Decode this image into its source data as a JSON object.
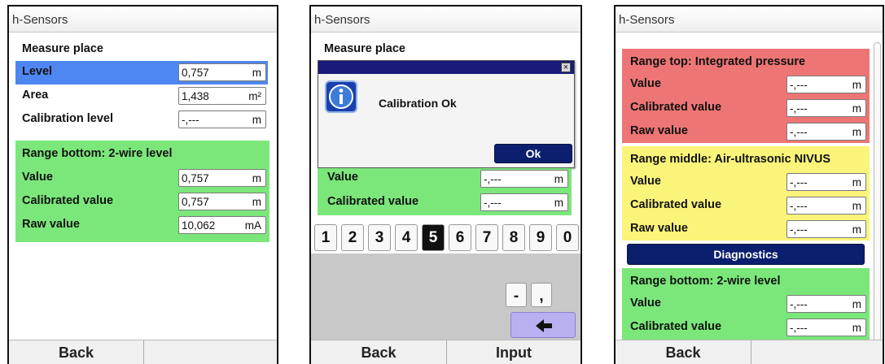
{
  "screens": [
    {
      "title": "h-Sensors",
      "measure_place": {
        "header": "Measure place",
        "level": {
          "label": "Level",
          "value": "0,757",
          "unit": "m"
        },
        "area": {
          "label": "Area",
          "value": "1,438",
          "unit": "m²"
        },
        "calibration_level": {
          "label": "Calibration level",
          "value": "-,---",
          "unit": "m"
        }
      },
      "range_bottom": {
        "header": "Range bottom: 2-wire level",
        "value": {
          "label": "Value",
          "value": "0,757",
          "unit": "m"
        },
        "calibrated_value": {
          "label": "Calibrated value",
          "value": "0,757",
          "unit": "m"
        },
        "raw_value": {
          "label": "Raw value",
          "value": "10,062",
          "unit": "mA"
        }
      },
      "footer": {
        "back": "Back"
      }
    },
    {
      "title": "h-Sensors",
      "measure_place_header": "Measure place",
      "dialog": {
        "message": "Calibration Ok",
        "ok": "Ok",
        "close": "×"
      },
      "value": {
        "label": "Value",
        "value": "-,---",
        "unit": "m"
      },
      "calibrated_value": {
        "label": "Calibrated value",
        "value": "-,---",
        "unit": "m"
      },
      "keypad": {
        "digits": [
          "1",
          "2",
          "3",
          "4",
          "5",
          "6",
          "7",
          "8",
          "9",
          "0"
        ],
        "selected": "5",
        "minus": "-",
        "comma": ",",
        "enter": "🡰"
      },
      "footer": {
        "back": "Back",
        "input": "Input"
      }
    },
    {
      "title": "h-Sensors",
      "range_top": {
        "header": "Range top: Integrated pressure",
        "value": {
          "label": "Value",
          "value": "-,---",
          "unit": "m"
        },
        "calibrated_value": {
          "label": "Calibrated value",
          "value": "-,---",
          "unit": "m"
        },
        "raw_value": {
          "label": "Raw value",
          "value": "-,---",
          "unit": "m"
        }
      },
      "range_middle": {
        "header": "Range middle: Air-ultrasonic NIVUS",
        "value": {
          "label": "Value",
          "value": "-,---",
          "unit": "m"
        },
        "calibrated_value": {
          "label": "Calibrated value",
          "value": "-,---",
          "unit": "m"
        },
        "raw_value": {
          "label": "Raw value",
          "value": "-,---",
          "unit": "m"
        }
      },
      "diagnostics": "Diagnostics",
      "range_bottom": {
        "header": "Range bottom: 2-wire level",
        "value": {
          "label": "Value",
          "value": "-,---",
          "unit": "m"
        },
        "calibrated_value": {
          "label": "Calibrated value",
          "value": "-,---",
          "unit": "m"
        }
      },
      "footer": {
        "back": "Back"
      }
    }
  ],
  "colors": {
    "selected_row": "#4f87f2",
    "range_bottom_bg": "#7be77b",
    "range_top_bg": "#ee7575",
    "range_middle_bg": "#fbf47a",
    "dialog_titlebar": "#1a1a7a",
    "button_navy": "#0c1f6e",
    "keypad_bg": "#c8c8c8",
    "enter_key": "#b8b0f0"
  }
}
